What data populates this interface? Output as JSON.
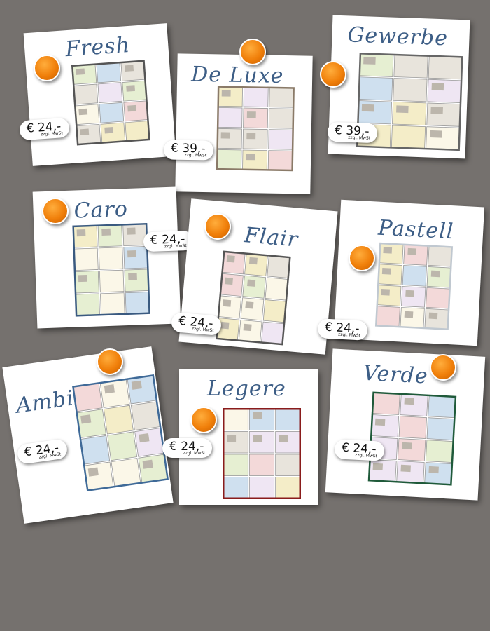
{
  "cards": [
    {
      "title": "Fresh",
      "price": "€ 24,-",
      "vat": "zzgl. MwSt",
      "border": "#555555"
    },
    {
      "title": "De Luxe",
      "price": "€ 39,-",
      "vat": "zzgl. MwSt",
      "border": "#8a7a68"
    },
    {
      "title": "Gewerbe",
      "price": "€ 39,-",
      "vat": "zzgl. MwSt",
      "border": "#666666"
    },
    {
      "title": "Caro",
      "price": "€ 24,-",
      "vat": "zzgl. MwSt",
      "border": "#3a5a80"
    },
    {
      "title": "Flair",
      "price": "€ 24,-",
      "vat": "zzgl. MwSt",
      "border": "#555555"
    },
    {
      "title": "Pastell",
      "price": "€ 24,-",
      "vat": "zzgl. MwSt",
      "border": "#c0c8d0"
    },
    {
      "title": "Ambiente",
      "price": "€ 24,-",
      "vat": "zzgl. MwSt",
      "border": "#3f6a98"
    },
    {
      "title": "Legere",
      "price": "€ 24,-",
      "vat": "zzgl. MwSt",
      "border": "#8a1c1c"
    },
    {
      "title": "Verde",
      "price": "€ 24,-",
      "vat": "zzgl. MwSt",
      "border": "#1f5a3a"
    }
  ],
  "colors": {
    "background": "#75716e",
    "pin": "#f07f0a",
    "title": "#3d5e86"
  }
}
